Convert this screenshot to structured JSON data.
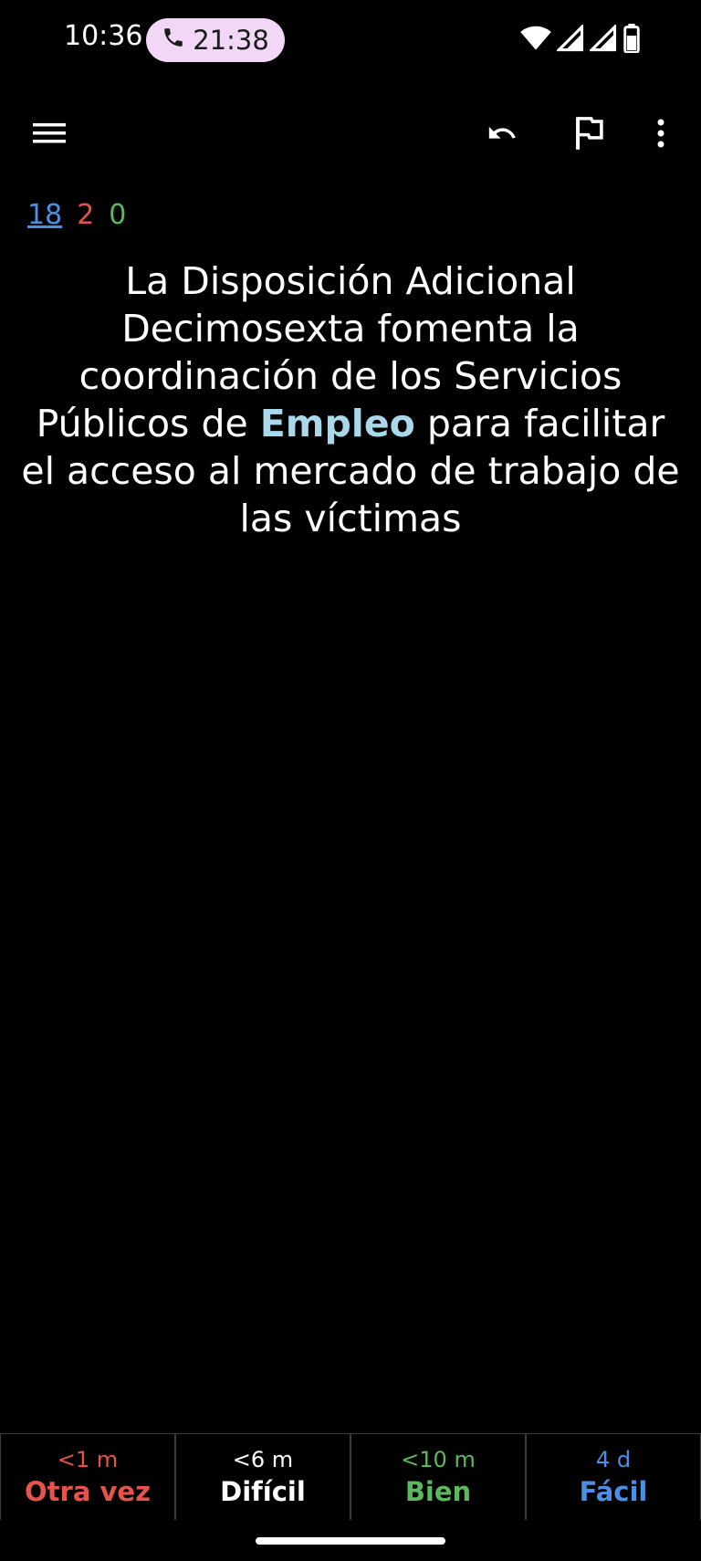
{
  "status_bar": {
    "time": "10:36",
    "call_timer": "21:38"
  },
  "counts": {
    "new": "18",
    "learn": "2",
    "review": "0"
  },
  "card": {
    "text_before": "La Disposición Adicional Decimosexta fomenta la coordinación de los Servicios Públicos de ",
    "highlight": "Empleo",
    "text_after": " para facilitar el acceso al mercado de trabajo de las víctimas"
  },
  "answers": [
    {
      "time": "<1 m",
      "label": "Otra vez",
      "color": "#e5534b"
    },
    {
      "time": "<6 m",
      "label": "Difícil",
      "color": "#ffffff"
    },
    {
      "time": "<10 m",
      "label": "Bien",
      "color": "#5cb85c"
    },
    {
      "time": "4 d",
      "label": "Fácil",
      "color": "#4a90e2"
    }
  ],
  "icons": {
    "menu": "menu-icon",
    "undo": "undo-icon",
    "flag": "flag-icon",
    "more": "more-vert-icon",
    "call": "phone-icon",
    "wifi": "wifi-icon",
    "signal": "signal-icon",
    "battery": "battery-icon"
  }
}
